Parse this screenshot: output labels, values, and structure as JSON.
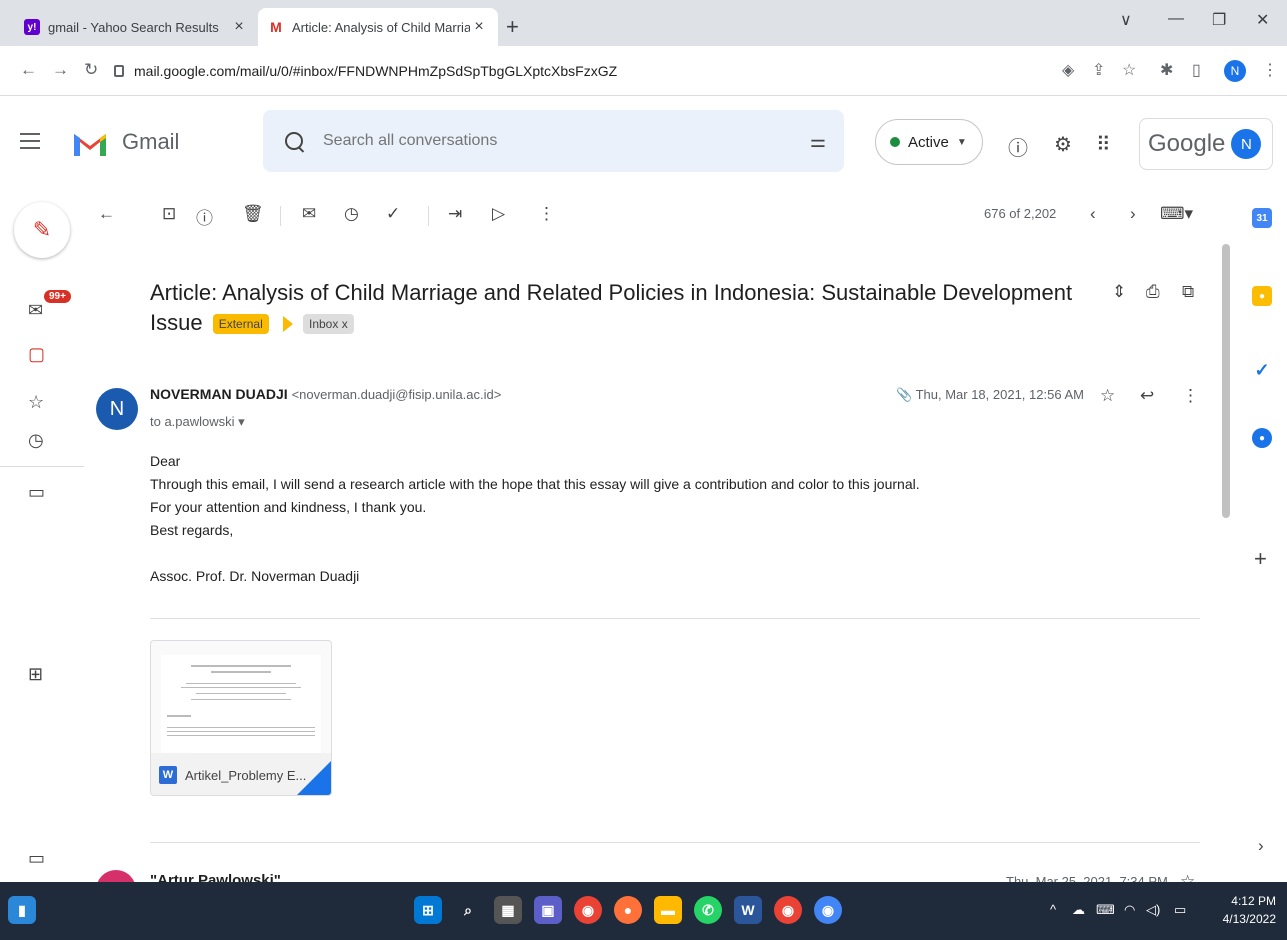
{
  "browser": {
    "tabs": [
      {
        "title": "gmail - Yahoo Search Results",
        "favicon": "yahoo-icon"
      },
      {
        "title": "Article: Analysis of Child Marriag",
        "favicon": "gmail-icon"
      }
    ],
    "url": "mail.google.com/mail/u/0/#inbox/FFNDWNPHmZpSdSpTbgGLXptcXbsFzxGZ",
    "profile_initial": "N"
  },
  "gmail": {
    "app_name": "Gmail",
    "search_placeholder": "Search all conversations",
    "status": "Active",
    "google_label": "Google",
    "account_initial": "N",
    "inbox_badge": "99+",
    "pagination": "676 of 2,202"
  },
  "email": {
    "subject": "Article: Analysis of Child Marriage and Related Policies in Indonesia: Sustainable Development Issue",
    "labels": [
      "External",
      "Inbox x"
    ],
    "sender_initial": "N",
    "sender_name": "NOVERMAN DUADJI",
    "sender_email": "<noverman.duadji@fisip.unila.ac.id>",
    "to": "to a.pawlowski",
    "date": "Thu, Mar 18, 2021, 12:56 AM",
    "body": [
      "Dear",
      "Through this email, I will send a research article with the hope that this essay will give a contribution and color to this journal.",
      "For your attention and kindness, I thank you.",
      "Best regards,",
      "",
      "Assoc. Prof. Dr. Noverman Duadji"
    ],
    "attachment": {
      "name": "Artikel_Problemy E...",
      "type_icon": "word-icon"
    }
  },
  "next_message": {
    "sender": "\"Artur Pawlowski\"",
    "date": "Thu, Mar 25, 2021, 7:34 PM"
  },
  "taskbar": {
    "time": "4:12 PM",
    "date": "4/13/2022"
  },
  "colors": {
    "gmail_red": "#d93025",
    "label_external": "#f9ba00",
    "taskbar_bg": "#1f2a3a",
    "search_bg": "#eaf1fb"
  }
}
